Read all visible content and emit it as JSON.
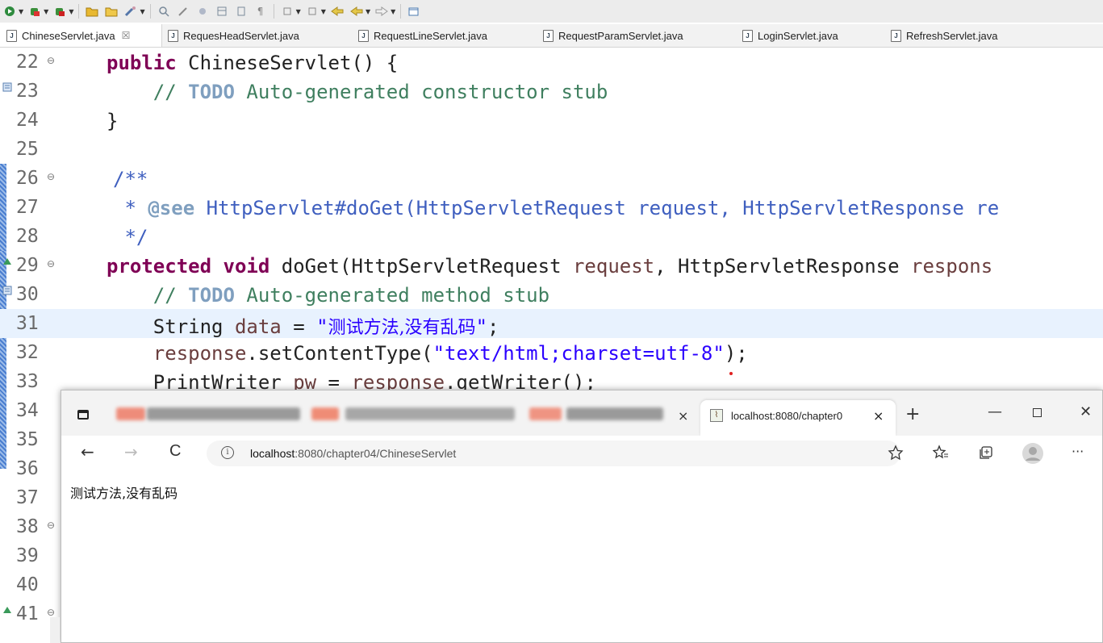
{
  "toolbar": {
    "icons": [
      "run-icon",
      "debug-icon",
      "external-tools-icon",
      "open-folder-icon",
      "open-project-icon",
      "wrench-icon",
      "search-icon",
      "pen-icon",
      "brush-icon",
      "layout-icon",
      "print-icon",
      "paragraph-icon",
      "step-into-icon",
      "step-over-icon",
      "back-icon",
      "back2-icon",
      "forward-icon",
      "new-window-icon"
    ]
  },
  "editor_tabs": [
    {
      "label": "ChineseServlet.java",
      "active": true,
      "close": "☒"
    },
    {
      "label": "RequesHeadServlet.java"
    },
    {
      "label": "RequestLineServlet.java"
    },
    {
      "label": "RequestParamServlet.java"
    },
    {
      "label": "LoginServlet.java"
    },
    {
      "label": "RefreshServlet.java"
    }
  ],
  "code_lines": [
    {
      "n": "22",
      "fold": "⊖"
    },
    {
      "n": "23",
      "marker": "task"
    },
    {
      "n": "24"
    },
    {
      "n": "25"
    },
    {
      "n": "26",
      "fold": "⊖"
    },
    {
      "n": "27"
    },
    {
      "n": "28"
    },
    {
      "n": "29",
      "fold": "⊖",
      "marker": "override"
    },
    {
      "n": "30",
      "marker": "task"
    },
    {
      "n": "31"
    },
    {
      "n": "32"
    },
    {
      "n": "33"
    },
    {
      "n": "34"
    },
    {
      "n": "35"
    },
    {
      "n": "36"
    },
    {
      "n": "37"
    },
    {
      "n": "38",
      "fold": "⊖"
    },
    {
      "n": "39"
    },
    {
      "n": "40"
    },
    {
      "n": "41",
      "fold": "⊖",
      "marker": "override"
    }
  ],
  "code": {
    "l22_kw": "public",
    "l22_rest": " ChineseServlet() {",
    "l23_cm1": "// ",
    "l23_todo": "TODO",
    "l23_cm2": " Auto-generated constructor stub",
    "l24": "}",
    "l26": "/**",
    "l27_star": " * ",
    "l27_tag": "@see",
    "l27_rest": " HttpServlet#doGet(HttpServletRequest request, HttpServletResponse re",
    "l28": " */",
    "l29_kw1": "protected",
    "l29_kw2": "void",
    "l29_a": " doGet(HttpServletRequest ",
    "l29_v1": "request",
    "l29_b": ", HttpServletResponse ",
    "l29_v2": "respons",
    "l30_cm1": "// ",
    "l30_todo": "TODO",
    "l30_cm2": " Auto-generated method stub",
    "l31_a": "String ",
    "l31_v": "data",
    "l31_b": " = ",
    "l31_s1": "\"",
    "l31_cn": "测试方法,没有乱码",
    "l31_s2": "\"",
    "l31_c": ";",
    "l32_v": "response",
    "l32_a": ".setContentType(",
    "l32_s": "\"text/html;charset=utf-8\"",
    "l32_b": ");",
    "l33_a": "PrintWriter ",
    "l33_v1": "pw",
    "l33_b": " = ",
    "l33_v2": "response",
    "l33_c": ".getWriter();"
  },
  "browser": {
    "tab_title": "localhost:8080/chapter0",
    "tab_close": "×",
    "inactive_tab_close": "×",
    "new_tab": "+",
    "minimize": "—",
    "close_window": "✕",
    "nav": {
      "back": "←",
      "forward": "→",
      "refresh": "C"
    },
    "url_host": "localhost",
    "url_rest": ":8080/chapter04/ChineseServlet",
    "info_icon": "i",
    "right_icons": [
      "favorites-add-icon",
      "favorites-icon",
      "collections-icon",
      "profile-icon",
      "more-icon"
    ],
    "more": "···",
    "page_text": "测试方法,没有乱码"
  },
  "colors": {
    "keyword": "#7f0055",
    "comment": "#3f7f5f",
    "javadoc": "#3f5fbf",
    "string": "#2a00ff",
    "variable": "#6a3e3e",
    "highlight_line": "#e8f2fe"
  }
}
